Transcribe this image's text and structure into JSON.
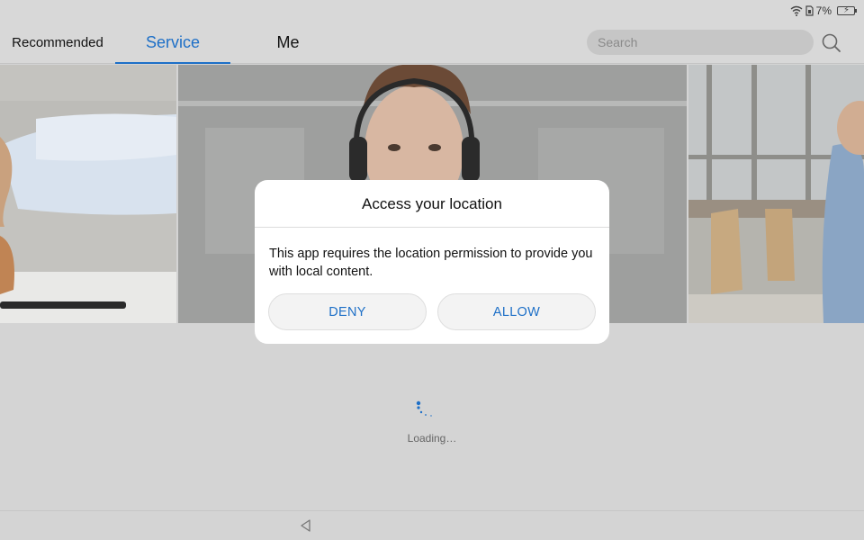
{
  "status_bar": {
    "battery_percent": "7%",
    "icons": [
      "wifi-icon",
      "sim-icon",
      "battery-charging-icon"
    ]
  },
  "header": {
    "tabs": [
      {
        "label": "Recommended",
        "selected": false
      },
      {
        "label": "Service",
        "selected": true
      },
      {
        "label": "Me",
        "selected": false
      }
    ],
    "search": {
      "placeholder": "Search",
      "icon": "search-icon"
    },
    "accent_color": "#1d6fc7"
  },
  "banner": {
    "slides": [
      {
        "name": "handshake-photo",
        "icon": "photo"
      },
      {
        "name": "support-agent-photo",
        "icon": "photo"
      },
      {
        "name": "office-cafe-photo",
        "icon": "photo"
      }
    ]
  },
  "loading": {
    "text": "Loading…"
  },
  "dialog": {
    "title": "Access your location",
    "message": "This app requires the location permission to provide you with local content.",
    "deny_label": "DENY",
    "allow_label": "ALLOW"
  },
  "nav_bar": {
    "icons": [
      "back-triangle-icon"
    ]
  }
}
